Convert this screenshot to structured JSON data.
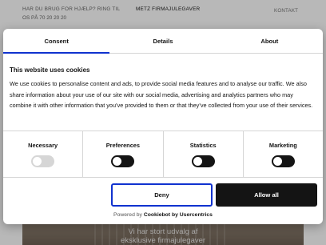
{
  "background": {
    "help_line1": "HAR DU BRUG FOR HJÆLP? RING TIL",
    "help_line2": "OS PÅ 70 20 20 20",
    "brand": "METZ FIRMAJULEGAVER",
    "contact": "KONTAKT",
    "hero_title_line1": "Vi har stort udvalg af",
    "hero_title_line2": "eksklusive firmajulegaver"
  },
  "dialog": {
    "tabs": [
      {
        "label": "Consent",
        "active": true
      },
      {
        "label": "Details",
        "active": false
      },
      {
        "label": "About",
        "active": false
      }
    ],
    "title": "This website uses cookies",
    "body": "We use cookies to personalise content and ads, to provide social media features and to analyse our traffic. We also share information about your use of our site with our social media, advertising and analytics partners who may combine it with other information that you’ve provided to them or that they’ve collected from your use of their services.",
    "switches": [
      {
        "label": "Necessary",
        "enabled": true,
        "disabled": true
      },
      {
        "label": "Preferences",
        "enabled": false,
        "disabled": false
      },
      {
        "label": "Statistics",
        "enabled": false,
        "disabled": false
      },
      {
        "label": "Marketing",
        "enabled": false,
        "disabled": false
      }
    ],
    "deny_label": "Deny",
    "allow_label": "Allow all",
    "powered_prefix": "Powered by",
    "powered_brand": "Cookiebot by Usercentrics"
  },
  "colors": {
    "accent": "#1032cf",
    "text": "#141414",
    "divider": "#d6d6d6"
  }
}
